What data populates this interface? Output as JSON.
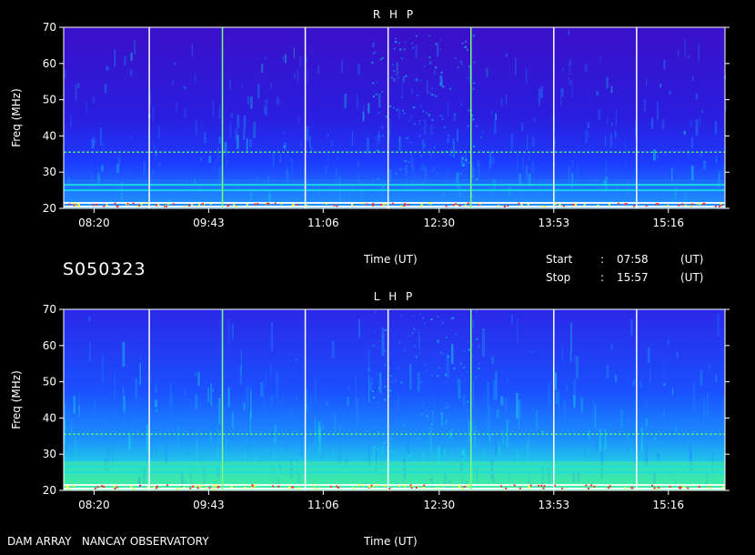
{
  "header": {
    "session_id": "S050323",
    "time_axis_label": "Time (UT)",
    "start_label": "Start",
    "start_value": "07:58",
    "stop_label": "Stop",
    "stop_value": "15:57",
    "separator": ":",
    "unit": "(UT)"
  },
  "footer": {
    "observatory": "DAM ARRAY   NANCAY OBSERVATORY"
  },
  "chart_data": [
    {
      "type": "heatmap",
      "title": "R H P",
      "ylabel": "Freq (MHz)",
      "xlabel": "",
      "xlim": [
        "07:58",
        "15:57"
      ],
      "ylim": [
        20,
        70
      ],
      "x_ticks": [
        "08:20",
        "09:43",
        "11:06",
        "12:30",
        "13:53",
        "15:16"
      ],
      "y_ticks": [
        20,
        30,
        40,
        50,
        60,
        70
      ],
      "grid": false,
      "vertical_markers": [
        {
          "time": "09:00",
          "color": "#ffffff"
        },
        {
          "time": "09:53",
          "color": "#7dff7d"
        },
        {
          "time": "10:53",
          "color": "#ffffff"
        },
        {
          "time": "11:53",
          "color": "#ffffff"
        },
        {
          "time": "12:53",
          "color": "#7dff7d"
        },
        {
          "time": "13:53",
          "color": "#ffffff"
        },
        {
          "time": "14:53",
          "color": "#ffffff"
        }
      ],
      "bright_bands_mhz": [
        20.5,
        21.5,
        25,
        26.5,
        35.5
      ],
      "background_level": "low",
      "colors": [
        "#3a10c8",
        "#1c3cff",
        "#1e88ff",
        "#17e0e0",
        "#5cff6a",
        "#ffff40",
        "#ff3030",
        "#ffffff"
      ]
    },
    {
      "type": "heatmap",
      "title": "L H P",
      "ylabel": "Freq (MHz)",
      "xlabel": "Time (UT)",
      "xlim": [
        "07:58",
        "15:57"
      ],
      "ylim": [
        20,
        70
      ],
      "x_ticks": [
        "08:20",
        "09:43",
        "11:06",
        "12:30",
        "13:53",
        "15:16"
      ],
      "y_ticks": [
        20,
        30,
        40,
        50,
        60,
        70
      ],
      "grid": false,
      "vertical_markers": [
        {
          "time": "09:00",
          "color": "#ffffff"
        },
        {
          "time": "09:53",
          "color": "#7dff7d"
        },
        {
          "time": "10:53",
          "color": "#ffffff"
        },
        {
          "time": "11:53",
          "color": "#ffffff"
        },
        {
          "time": "12:53",
          "color": "#7dff7d"
        },
        {
          "time": "13:53",
          "color": "#ffffff"
        },
        {
          "time": "14:53",
          "color": "#ffffff"
        }
      ],
      "bright_bands_mhz": [
        20.5,
        21.5,
        25,
        26.5,
        35.5
      ],
      "background_level": "high",
      "colors": [
        "#3a10c8",
        "#1c3cff",
        "#1e88ff",
        "#17e0e0",
        "#5cff6a",
        "#ffff40",
        "#ff3030",
        "#ffffff"
      ]
    }
  ]
}
